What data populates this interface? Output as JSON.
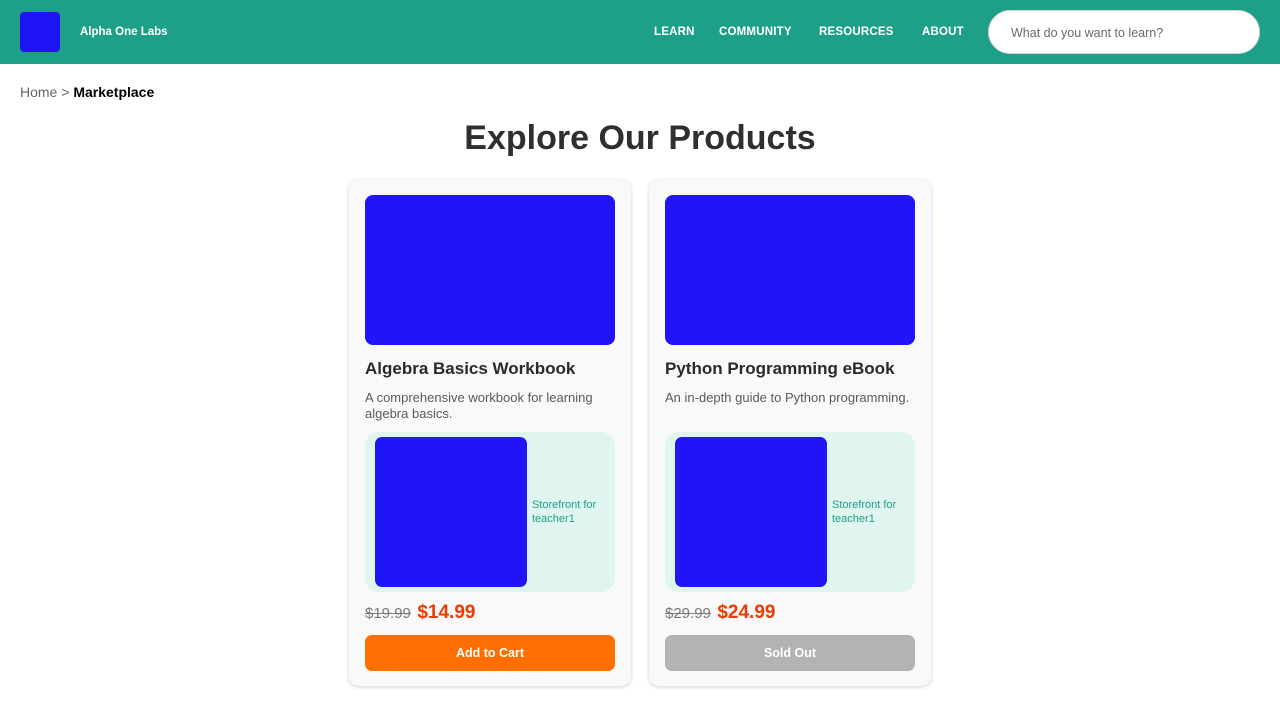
{
  "header": {
    "brand": "Alpha One Labs",
    "logo_color": "#2014f8",
    "background_color": "#1ea088",
    "nav": [
      "LEARN",
      "COMMUNITY",
      "RESOURCES",
      "ABOUT"
    ],
    "search_placeholder": "What do you want to learn?"
  },
  "breadcrumb": {
    "home": "Home",
    "separator": ">",
    "current": "Marketplace"
  },
  "page_title": "Explore Our Products",
  "products": [
    {
      "title": "Algebra Basics Workbook",
      "description": "A comprehensive workbook for learning algebra basics.",
      "storefront": "Storefront for teacher1",
      "old_price": "$19.99",
      "price": "$14.99",
      "action": "Add to Cart",
      "available": true
    },
    {
      "title": "Python Programming eBook",
      "description": "An in-depth guide to Python programming.",
      "storefront": "Storefront for teacher1",
      "old_price": "$29.99",
      "price": "$24.99",
      "action": "Sold Out",
      "available": false
    }
  ],
  "colors": {
    "accent": "#1ea088",
    "image_placeholder": "#2014f8",
    "sale_price": "#f03a00",
    "add_to_cart": "#ff6e00",
    "sold_out": "#b3b3b3"
  }
}
